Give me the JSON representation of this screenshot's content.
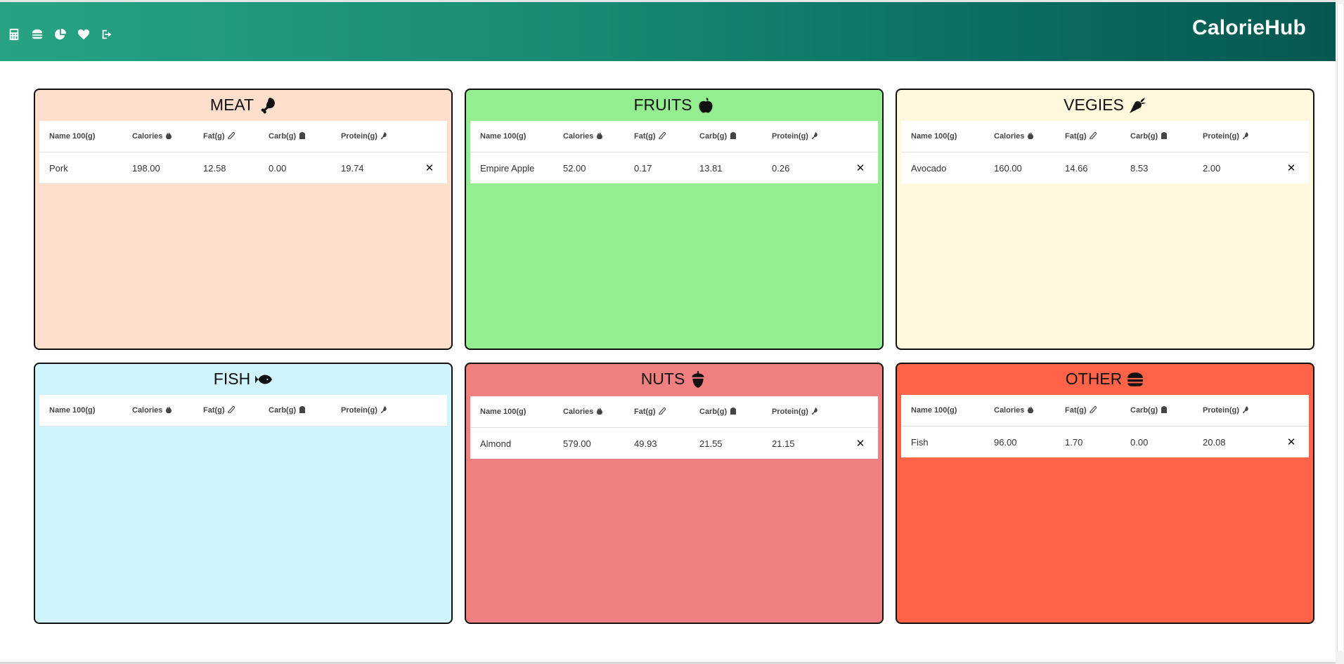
{
  "app": {
    "brand": "CalorieHub"
  },
  "nav": [
    "calculator-icon",
    "burger-icon",
    "pie-chart-icon",
    "heart-icon",
    "logout-icon"
  ],
  "columns": [
    "Name 100(g)",
    "Calories",
    "Fat(g)",
    "Carb(g)",
    "Protein(g)"
  ],
  "panels": {
    "meat": {
      "title": "MEAT",
      "icon": "drumstick-icon",
      "color": "#ffdecb",
      "rows": [
        {
          "name": "Pork",
          "calories": "198.00",
          "fat": "12.58",
          "carb": "0.00",
          "protein": "19.74"
        }
      ]
    },
    "fruits": {
      "title": "FRUITS",
      "icon": "apple-icon",
      "color": "#93ee8f",
      "rows": [
        {
          "name": "Empire Apple",
          "calories": "52.00",
          "fat": "0.17",
          "carb": "13.81",
          "protein": "0.26"
        }
      ]
    },
    "vegies": {
      "title": "VEGIES",
      "icon": "carrot-icon",
      "color": "#fff8dc",
      "rows": [
        {
          "name": "Avocado",
          "calories": "160.00",
          "fat": "14.66",
          "carb": "8.53",
          "protein": "2.00"
        }
      ]
    },
    "fish": {
      "title": "FISH",
      "icon": "fish-icon",
      "color": "#d0f4fc",
      "rows": []
    },
    "nuts": {
      "title": "NUTS",
      "icon": "acorn-icon",
      "color": "#f08080",
      "rows": [
        {
          "name": "Almond",
          "calories": "579.00",
          "fat": "49.93",
          "carb": "21.55",
          "protein": "21.15"
        }
      ]
    },
    "other": {
      "title": "OTHER",
      "icon": "burger-icon",
      "color": "#ff6448",
      "rows": [
        {
          "name": "Fish",
          "calories": "96.00",
          "fat": "1.70",
          "carb": "0.00",
          "protein": "20.08"
        }
      ]
    }
  },
  "delete_glyph": "✕"
}
